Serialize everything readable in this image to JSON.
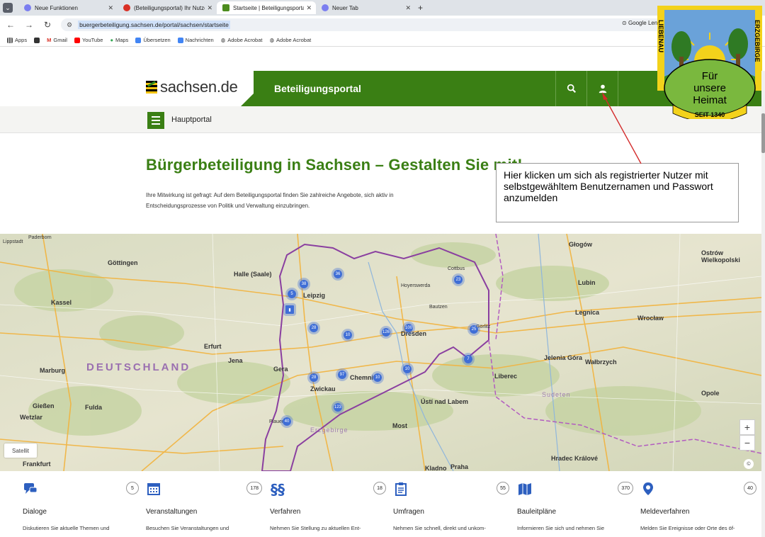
{
  "browser": {
    "tabs": [
      {
        "title": "Neue Funktionen",
        "color": "#7b7ef0"
      },
      {
        "title": "(Beteiligungsportal) Ihr Nutzer",
        "color": "#d93025"
      },
      {
        "title": "Startseite | Beteiligungsportal S",
        "color": "#4c8c1e"
      },
      {
        "title": "Neuer Tab",
        "color": "#7b7ef0"
      }
    ],
    "url": "buergerbeteiligung.sachsen.de/portal/sachsen/startseite",
    "google_lens": "Google Lens",
    "bookmarks": [
      {
        "label": "Apps",
        "color": "#555"
      },
      {
        "label": "",
        "color": "#333"
      },
      {
        "label": "Gmail",
        "color": "#d93025"
      },
      {
        "label": "YouTube",
        "color": "#ff0000"
      },
      {
        "label": "Maps",
        "color": "#34a853"
      },
      {
        "label": "Übersetzen",
        "color": "#4285f4"
      },
      {
        "label": "Nachrichten",
        "color": "#4285f4"
      },
      {
        "label": "Adobe Acrobat",
        "color": "#333"
      },
      {
        "label": "Adobe Acrobat",
        "color": "#333"
      }
    ]
  },
  "header": {
    "logo_text": "sachsen.de",
    "portal_title": "Beteiligungsportal",
    "subnav_label": "Hauptportal",
    "accent_color": "#3a7f14"
  },
  "hero": {
    "title": "Bürgerbeteiligung in Sachsen – Gestalten Sie mit!",
    "text": "Ihre Mitwirkung ist gefragt: Auf dem Beteiligungsportal finden Sie zahlreiche Angebote, sich aktiv in Entscheidungsprozesse von Politik und Verwaltung einzubringen."
  },
  "annotation": {
    "text": "Hier klicken um sich als registrierter Nutzer mit selbstgewähltem Benutzernamen und Passwort anzumelden"
  },
  "badge": {
    "top_text": "LIEBENAU",
    "side_text": "ERZGEBIRGE",
    "motto_1": "Für",
    "motto_2": "unsere",
    "motto_3": "Heimat",
    "since": "SEIT 1340"
  },
  "map": {
    "satellite_label": "Satellit",
    "zoom_in": "+",
    "zoom_out": "−",
    "copyright": "©",
    "regions": [
      {
        "label": "DEUTSCHLAND",
        "big": true
      },
      {
        "label": "Sudeten",
        "big": false
      },
      {
        "label": "Erzgebirge",
        "big": false
      }
    ],
    "cities": [
      {
        "name": "Paderborn"
      },
      {
        "name": "Lippstadt"
      },
      {
        "name": "Göttingen"
      },
      {
        "name": "Kassel"
      },
      {
        "name": "Halle (Saale)"
      },
      {
        "name": "Leipzig"
      },
      {
        "name": "Dresden"
      },
      {
        "name": "Erfurt"
      },
      {
        "name": "Jena"
      },
      {
        "name": "Gera"
      },
      {
        "name": "Chemnitz"
      },
      {
        "name": "Zwickau"
      },
      {
        "name": "Marburg"
      },
      {
        "name": "Fulda"
      },
      {
        "name": "Frankfurt"
      },
      {
        "name": "Gießen"
      },
      {
        "name": "Wetzlar"
      },
      {
        "name": "Głogów"
      },
      {
        "name": "Legnica"
      },
      {
        "name": "Wrocław"
      },
      {
        "name": "Wałbrzych"
      },
      {
        "name": "Opole"
      },
      {
        "name": "Liberec"
      },
      {
        "name": "Ústí nad Labem"
      },
      {
        "name": "Praha"
      },
      {
        "name": "Hradec Králové"
      },
      {
        "name": "Jelenia Góra"
      },
      {
        "name": "Bautzen"
      },
      {
        "name": "Görlitz"
      },
      {
        "name": "Plauen"
      },
      {
        "name": "Cottbus"
      },
      {
        "name": "Hoyerswerda"
      },
      {
        "name": "Ostrów Wielkopolski"
      },
      {
        "name": "Kladno"
      },
      {
        "name": "Most"
      },
      {
        "name": "Lubin"
      }
    ],
    "clusters": [
      "5",
      "38",
      "36",
      "28",
      "10",
      "126",
      "100",
      "23",
      "25",
      "7",
      "10",
      "28",
      "97",
      "10",
      "123",
      "40"
    ]
  },
  "categories": [
    {
      "name": "Dialoge",
      "count": "5",
      "desc": "Diskutieren Sie aktuelle Themen und",
      "icon": "chat-icon"
    },
    {
      "name": "Veranstaltungen",
      "count": "178",
      "desc": "Besuchen Sie Veranstaltungen und",
      "icon": "calendar-icon"
    },
    {
      "name": "Verfahren",
      "count": "18",
      "desc": "Nehmen Sie Stellung zu aktuellen Ent-",
      "icon": "paragraph-icon"
    },
    {
      "name": "Umfragen",
      "count": "55",
      "desc": "Nehmen Sie schnell, direkt und unkom-",
      "icon": "clipboard-icon"
    },
    {
      "name": "Bauleitpläne",
      "count": "370",
      "desc": "Informieren Sie sich und nehmen Sie",
      "icon": "map-icon"
    },
    {
      "name": "Meldeverfahren",
      "count": "40",
      "desc": "Melden Sie Ereignisse oder Orte des öf-",
      "icon": "pin-icon"
    }
  ]
}
